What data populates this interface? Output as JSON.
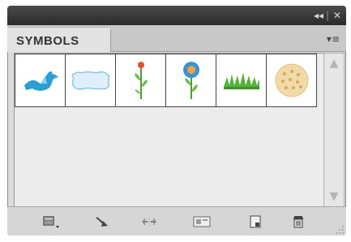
{
  "panel": {
    "tab_label": "SYMBOLS",
    "title_controls": {
      "collapse": "◂◂",
      "separator": "|",
      "close": "✕"
    },
    "menu_icon": "panel-menu-icon",
    "symbols": [
      {
        "name": "bird-symbol",
        "icon": "bird"
      },
      {
        "name": "cloud-banner-symbol",
        "icon": "cloud-banner"
      },
      {
        "name": "red-flower-symbol",
        "icon": "red-flower"
      },
      {
        "name": "blue-flower-symbol",
        "icon": "blue-flower"
      },
      {
        "name": "grass-symbol",
        "icon": "grass"
      },
      {
        "name": "dotted-blob-symbol",
        "icon": "dotted-blob"
      }
    ],
    "footer": {
      "buttons": [
        {
          "name": "symbol-libraries-menu-button",
          "icon": "library-menu"
        },
        {
          "name": "place-symbol-instance-button",
          "icon": "place-arrow"
        },
        {
          "name": "break-link-button",
          "icon": "break-link"
        },
        {
          "name": "symbol-options-button",
          "icon": "options"
        },
        {
          "name": "new-symbol-button",
          "icon": "new-page"
        },
        {
          "name": "delete-symbol-button",
          "icon": "trash"
        }
      ]
    }
  }
}
